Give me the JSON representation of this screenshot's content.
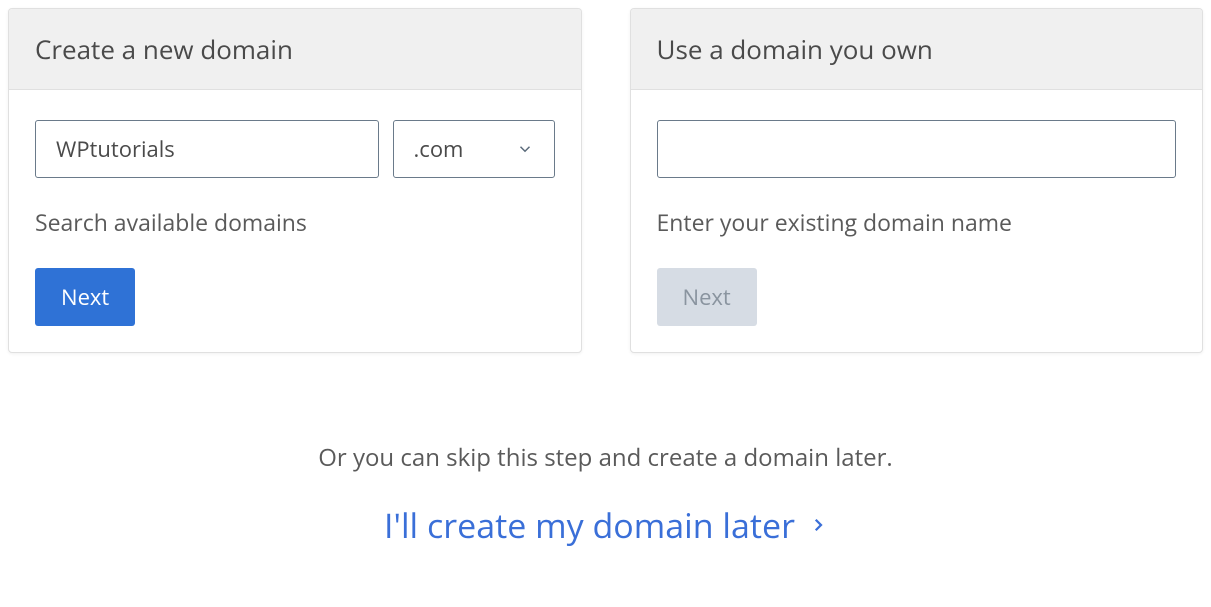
{
  "create": {
    "title": "Create a new domain",
    "domain_input_value": "WPtutorials",
    "tld_selected": ".com",
    "helper": "Search available domains",
    "next_label": "Next"
  },
  "use": {
    "title": "Use a domain you own",
    "domain_input_value": "",
    "helper": "Enter your existing domain name",
    "next_label": "Next"
  },
  "skip": {
    "prompt": "Or you can skip this step and create a domain later.",
    "link_label": "I'll create my domain later"
  }
}
